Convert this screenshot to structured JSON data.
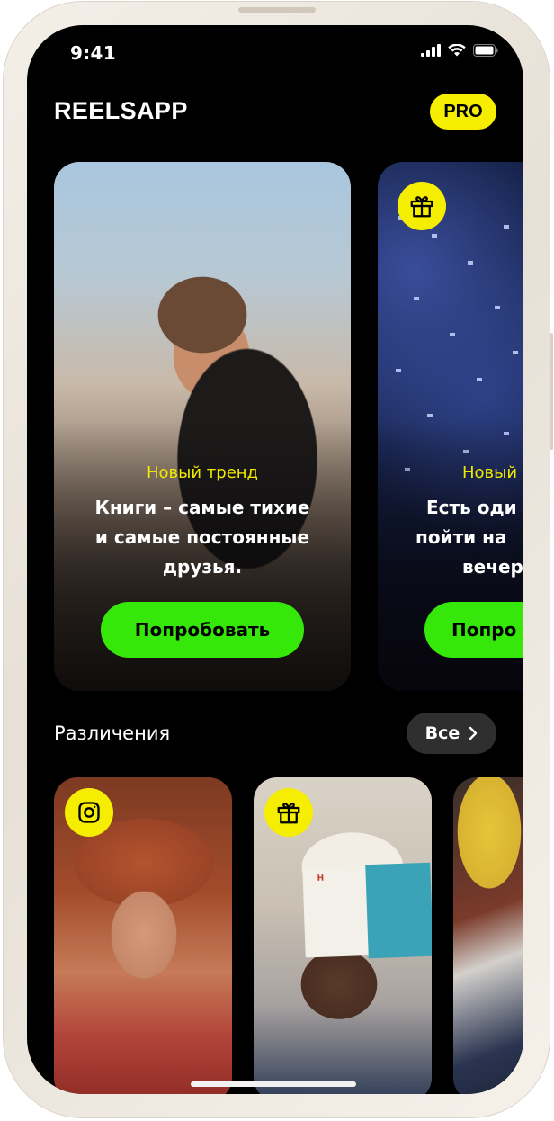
{
  "status_bar": {
    "time": "9:41",
    "icons": [
      "signal-icon",
      "wifi-icon",
      "battery-icon"
    ]
  },
  "header": {
    "app_title": "REELSAPP",
    "pro_label": "PRO"
  },
  "hero_cards": [
    {
      "tag": "Новый тренд",
      "text_lines": [
        "Книги – самые тихие",
        "и самые постоянные",
        "друзья."
      ],
      "button": "Попробовать",
      "icon": null
    },
    {
      "tag": "Новый",
      "text_lines": [
        "Есть оди",
        "пойти на",
        "вечер"
      ],
      "button": "Попро",
      "icon": "gift-icon"
    }
  ],
  "section": {
    "title": "Различения",
    "all_label": "Все"
  },
  "thumbnails": [
    {
      "icon": "instagram-icon"
    },
    {
      "icon": "gift-icon",
      "book_letter": "Н"
    },
    {
      "icon": null
    }
  ],
  "colors": {
    "accent_yellow": "#f5ee00",
    "accent_green": "#35e80a",
    "background": "#000000"
  }
}
